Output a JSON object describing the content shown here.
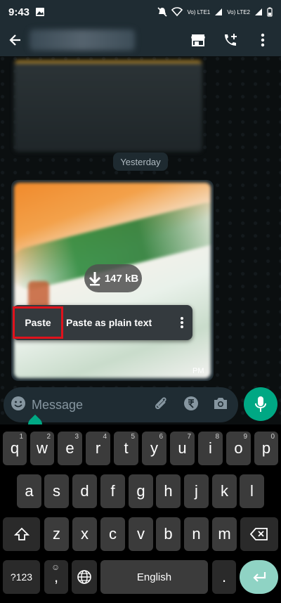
{
  "status_bar": {
    "time": "9:43",
    "sim1": "Vo) LTE1",
    "sim2": "Vo) LTE2"
  },
  "chat": {
    "date_chip": "Yesterday",
    "download_size": "147 kB",
    "time_partial": "PM"
  },
  "context_menu": {
    "paste_label": "Paste",
    "paste_plain_label": "Paste as plain text"
  },
  "input": {
    "placeholder": "Message"
  },
  "keyboard": {
    "row1": [
      {
        "key": "q",
        "hint": "1"
      },
      {
        "key": "w",
        "hint": "2"
      },
      {
        "key": "e",
        "hint": "3"
      },
      {
        "key": "r",
        "hint": "4"
      },
      {
        "key": "t",
        "hint": "5"
      },
      {
        "key": "y",
        "hint": "6"
      },
      {
        "key": "u",
        "hint": "7"
      },
      {
        "key": "i",
        "hint": "8"
      },
      {
        "key": "o",
        "hint": "9"
      },
      {
        "key": "p",
        "hint": "0"
      }
    ],
    "row2": [
      "a",
      "s",
      "d",
      "f",
      "g",
      "h",
      "j",
      "k",
      "l"
    ],
    "row3": [
      "z",
      "x",
      "c",
      "v",
      "b",
      "n",
      "m"
    ],
    "symbols_label": "?123",
    "comma": ",",
    "period": ".",
    "space_label": "English"
  },
  "icons": {
    "back": "arrow-left-icon",
    "shop": "storefront-icon",
    "add_call": "phone-plus-icon",
    "more": "more-vertical-icon",
    "emoji": "emoji-icon",
    "attach": "paperclip-icon",
    "rupee": "rupee-icon",
    "camera": "camera-icon",
    "mic": "mic-icon"
  },
  "colors": {
    "accent": "#00a884",
    "header_bg": "#1f2c33",
    "highlight": "#e0121c"
  }
}
